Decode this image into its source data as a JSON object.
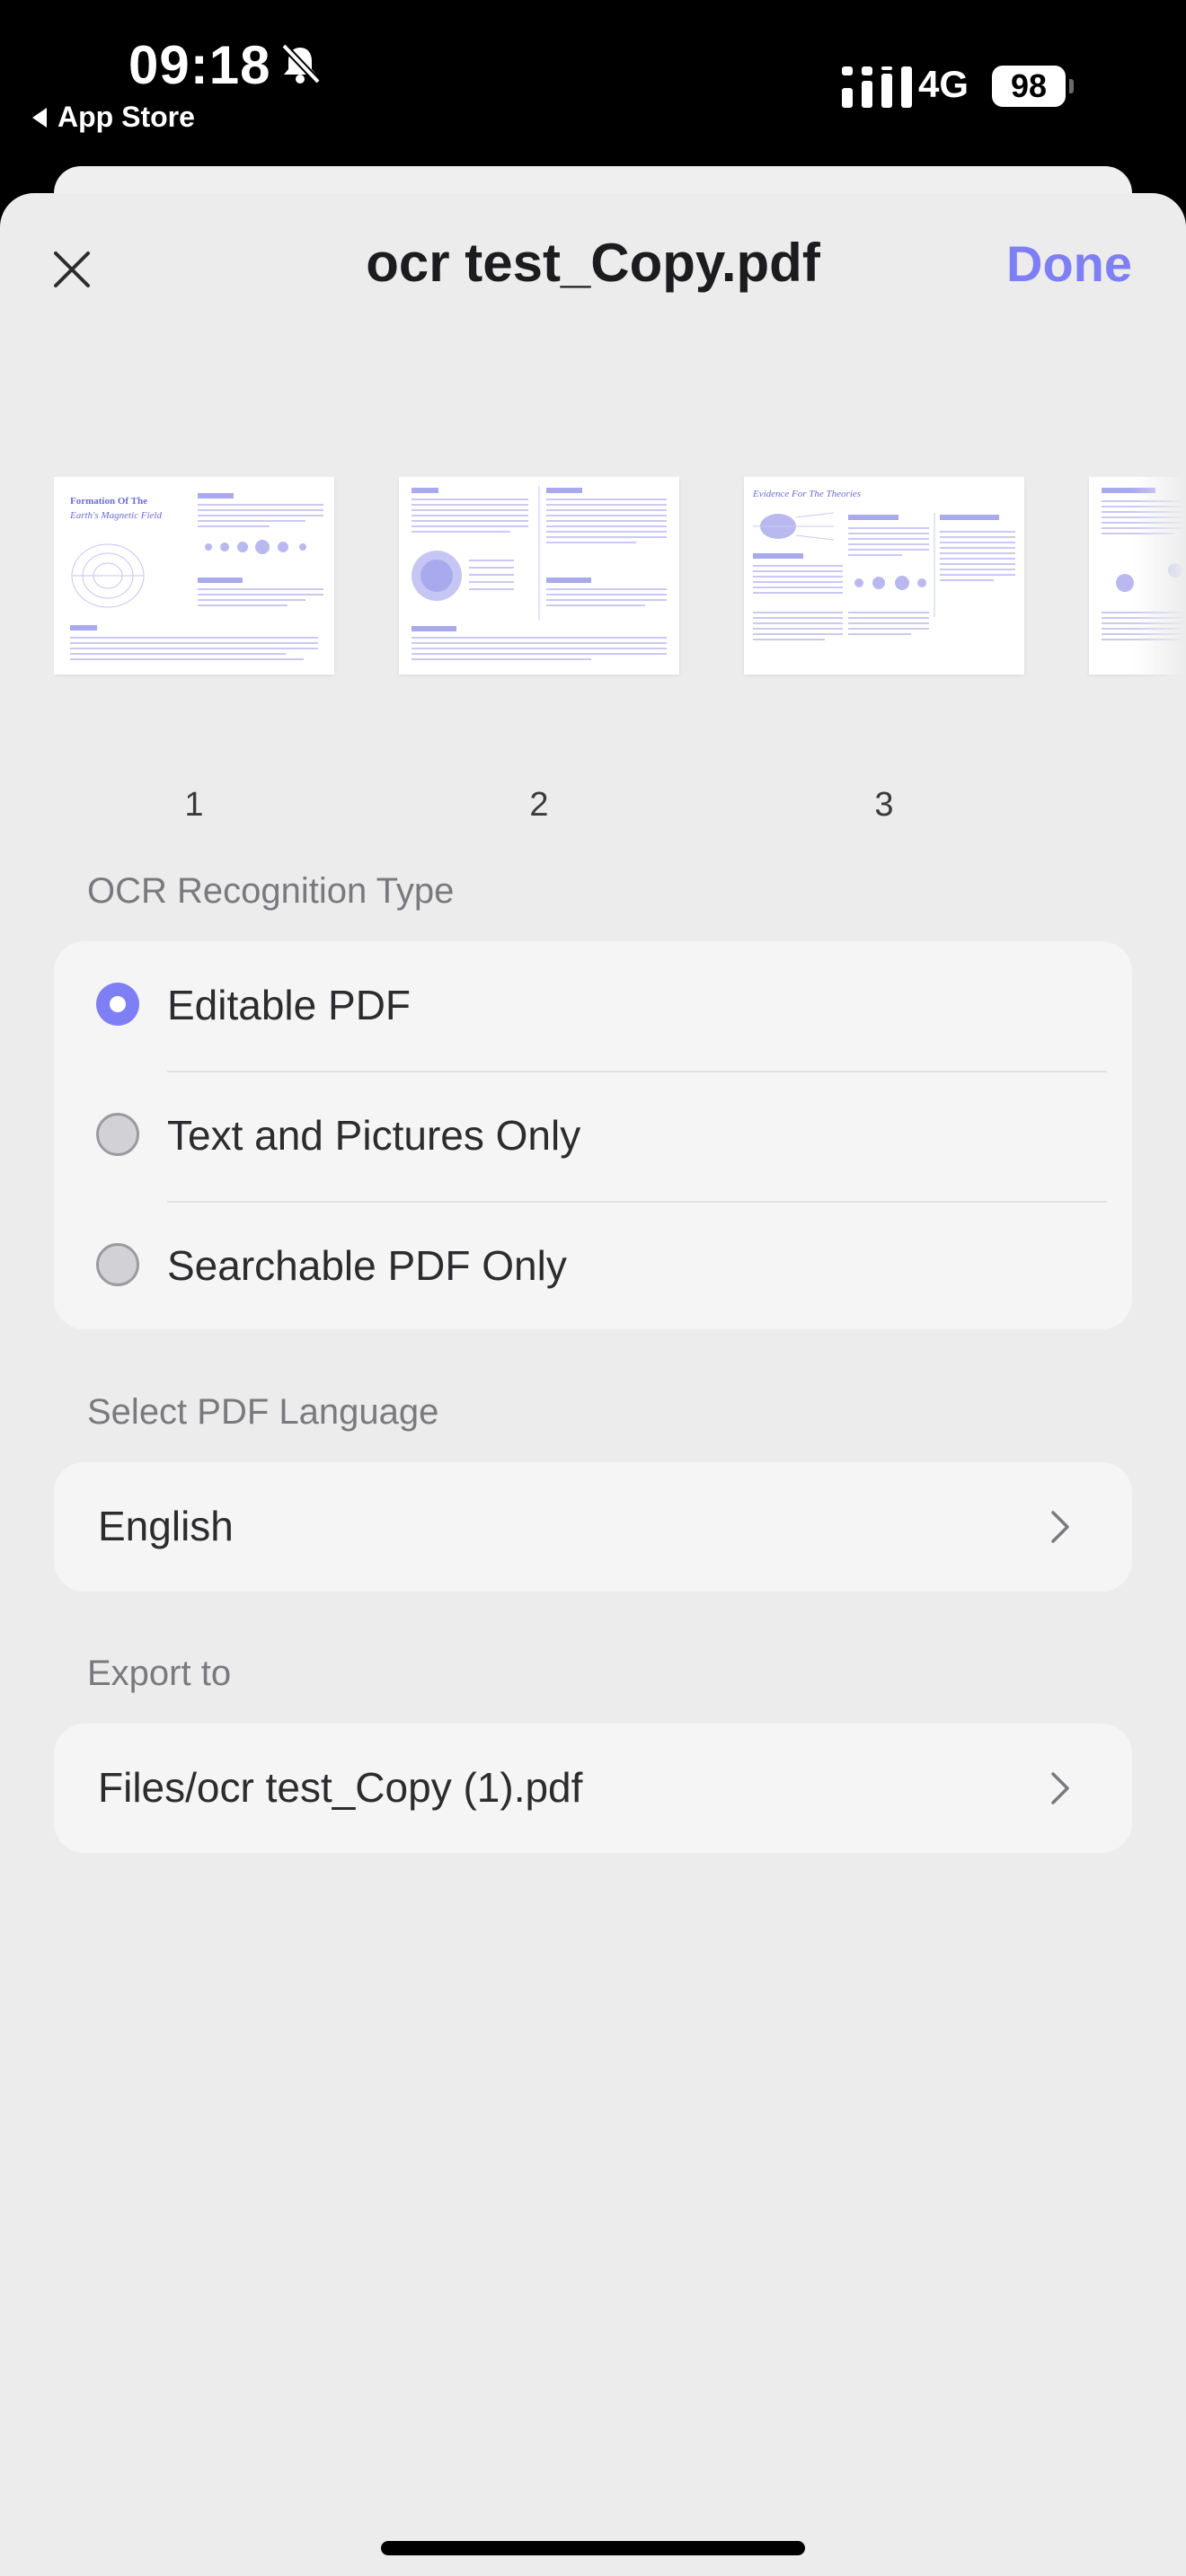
{
  "status_bar": {
    "time": "09:18",
    "back_app": "App Store",
    "network": "4G",
    "battery": "98"
  },
  "header": {
    "title": "ocr test_Copy.pdf",
    "done_label": "Done"
  },
  "pages": [
    {
      "number": "1",
      "heading": "Formation Of The Earth's Magnetic Field"
    },
    {
      "number": "2"
    },
    {
      "number": "3",
      "heading": "Evidence For The Theories"
    }
  ],
  "ocr": {
    "section_label": "OCR Recognition Type",
    "options": [
      {
        "label": "Editable PDF",
        "selected": true
      },
      {
        "label": "Text and Pictures Only",
        "selected": false
      },
      {
        "label": "Searchable PDF Only",
        "selected": false
      }
    ]
  },
  "language": {
    "section_label": "Select PDF Language",
    "value": "English"
  },
  "export": {
    "section_label": "Export to",
    "value": "Files/ocr test_Copy (1).pdf"
  },
  "colors": {
    "accent": "#7f7ff5",
    "sheet_background": "#ececec",
    "card_background": "#f5f5f5"
  }
}
